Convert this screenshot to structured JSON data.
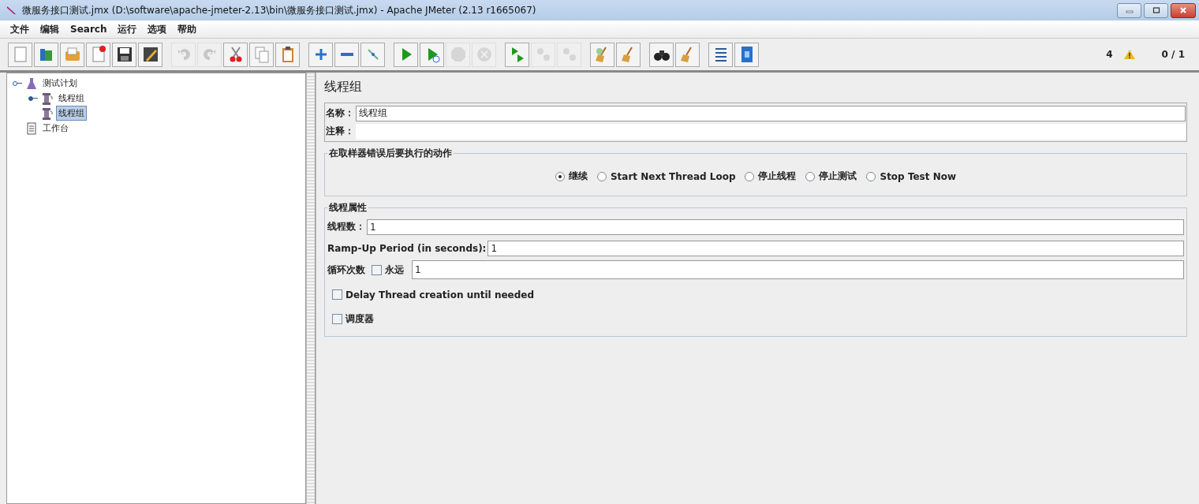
{
  "window": {
    "title": "微服务接口测试.jmx (D:\\software\\apache-jmeter-2.13\\bin\\微服务接口测试.jmx) - Apache JMeter (2.13 r1665067)"
  },
  "menu": [
    "文件",
    "编辑",
    "Search",
    "运行",
    "选项",
    "帮助"
  ],
  "toolbar_groups": [
    [
      {
        "disabled": false
      },
      {
        "disabled": false
      },
      {
        "disabled": false
      },
      {
        "disabled": false
      },
      {
        "disabled": false
      },
      {
        "disabled": false
      }
    ],
    [
      {
        "disabled": true
      },
      {
        "disabled": true
      },
      {
        "disabled": false
      },
      {
        "disabled": false
      },
      {
        "disabled": false
      }
    ],
    [
      {
        "disabled": false
      },
      {
        "disabled": false
      },
      {
        "disabled": false
      }
    ],
    [
      {
        "disabled": false
      },
      {
        "disabled": false
      },
      {
        "disabled": true
      },
      {
        "disabled": true
      }
    ],
    [
      {
        "disabled": false
      },
      {
        "disabled": true
      },
      {
        "disabled": true
      }
    ],
    [
      {
        "disabled": false
      },
      {
        "disabled": false
      }
    ],
    [
      {
        "disabled": false
      },
      {
        "disabled": false
      }
    ],
    [
      {
        "disabled": false
      },
      {
        "disabled": false
      }
    ]
  ],
  "status": {
    "warning_count": "4",
    "threads": "0 / 1"
  },
  "tree": [
    {
      "label": "测试计划",
      "kind": "plan",
      "expanded": true,
      "selected": false,
      "children": [
        {
          "label": "线程组",
          "kind": "threads",
          "expanded": false,
          "selected": false
        },
        {
          "label": "线程组",
          "kind": "threads",
          "selected": true
        }
      ]
    },
    {
      "label": "工作台",
      "kind": "workbench",
      "selected": false
    }
  ],
  "panel": {
    "title": "线程组",
    "name_label": "名称：",
    "name_value": "线程组",
    "comment_label": "注释：",
    "error_action": {
      "title": "在取样器错误后要执行的动作",
      "options": [
        {
          "label": "继续",
          "selected": true
        },
        {
          "label": "Start Next Thread Loop",
          "selected": false
        },
        {
          "label": "停止线程",
          "selected": false
        },
        {
          "label": "停止测试",
          "selected": false
        },
        {
          "label": "Stop Test Now",
          "selected": false
        }
      ]
    },
    "thread_properties": {
      "title": "线程属性",
      "threads_label": "线程数：",
      "threads_value": "1",
      "rampup_label": "Ramp-Up Period (in seconds):",
      "rampup_value": "1",
      "loop_label": "循环次数",
      "forever_label": "永远",
      "forever_checked": false,
      "loop_value": "1",
      "delay_label": "Delay Thread creation until needed",
      "delay_checked": false,
      "scheduler_label": "调度器",
      "scheduler_checked": false
    }
  }
}
